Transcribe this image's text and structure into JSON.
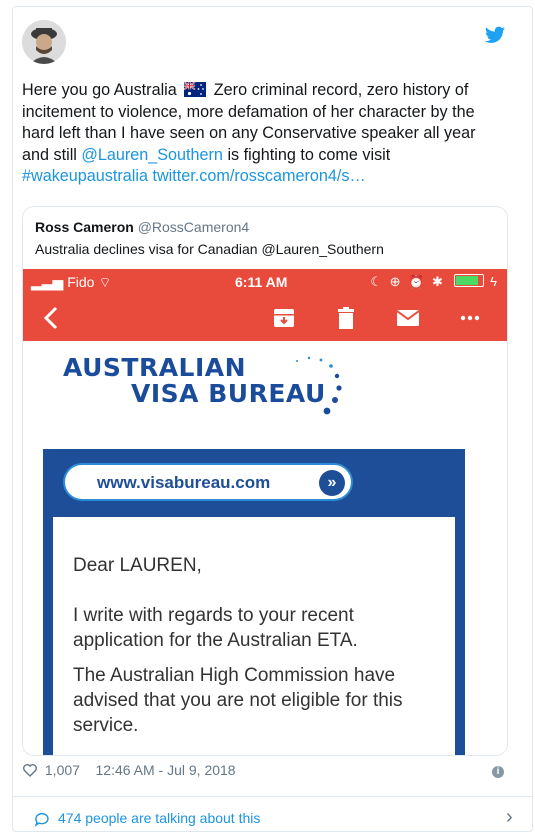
{
  "tweet": {
    "text_before": "Here you go Australia",
    "text_after": "Zero criminal record, zero history of incitement to violence, more defamation of her character by the hard left than I have seen on any Conservative speaker all year and still",
    "mention": "@Lauren_Southern",
    "text_after_mention": "is fighting to come visit",
    "hashtag": "#wakeupaustralia",
    "link": "twitter.com/rosscameron4/s…",
    "flag_icon": "australia-flag-icon",
    "likes": "1,007",
    "timestamp": "12:46 AM - Jul 9, 2018",
    "talking": "474 people are talking about this",
    "colors": {
      "link": "#1b95e0",
      "text": "#14171a",
      "muted": "#657786"
    }
  },
  "quoted": {
    "author_name": "Ross Cameron",
    "author_handle": "@RossCameron4",
    "text": "Australia declines visa for Canadian @Lauren_Southern"
  },
  "phone": {
    "carrier": "Fido",
    "time": "6:11 AM",
    "accent_color": "#e84b3c",
    "toolbar_icons": [
      "back-arrow-icon",
      "archive-icon",
      "trash-icon",
      "mail-icon",
      "more-icon"
    ]
  },
  "email": {
    "logo_line1": "AUSTRALIAN",
    "logo_line2": "VISA BUREAU",
    "url": "www.visabureau.com",
    "greeting": "Dear LAUREN,",
    "para1": "I write with regards to your recent application for the Australian ETA.",
    "para2": "The Australian High Commission have advised that you are not eligible for this service."
  }
}
